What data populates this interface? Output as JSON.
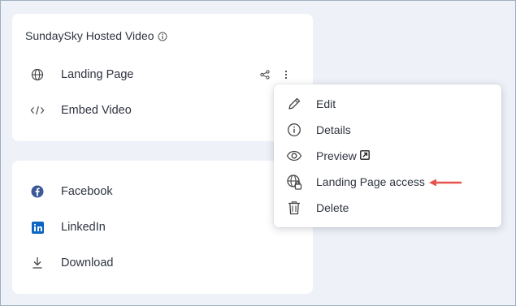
{
  "card_hosted": {
    "title": "SundaySky Hosted Video",
    "items": [
      {
        "label": "Landing Page",
        "icon": "globe-icon"
      },
      {
        "label": "Embed Video",
        "icon": "code-icon"
      }
    ]
  },
  "card_share": {
    "items": [
      {
        "label": "Facebook",
        "icon": "facebook-icon"
      },
      {
        "label": "LinkedIn",
        "icon": "linkedin-icon"
      },
      {
        "label": "Download",
        "icon": "download-icon"
      }
    ]
  },
  "context_menu": {
    "items": [
      {
        "label": "Edit",
        "icon": "pencil-icon"
      },
      {
        "label": "Details",
        "icon": "info-icon"
      },
      {
        "label": "Preview",
        "icon": "eye-icon"
      },
      {
        "label": "Landing Page access",
        "icon": "globe-lock-icon"
      },
      {
        "label": "Delete",
        "icon": "trash-icon"
      }
    ]
  },
  "colors": {
    "background": "#eef1f7",
    "annotation_arrow": "#e5534b",
    "facebook": "#3b5998",
    "linkedin": "#0a66c2"
  }
}
